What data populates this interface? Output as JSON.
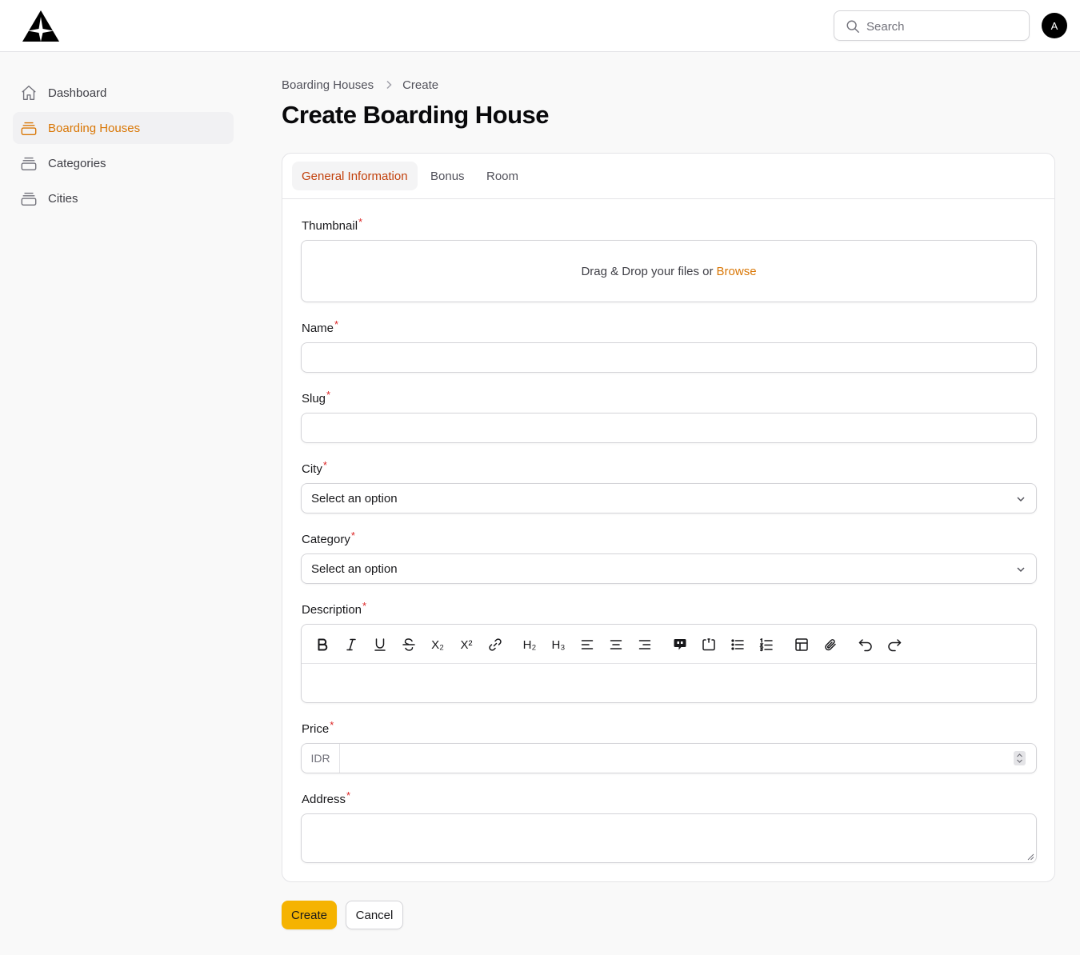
{
  "header": {
    "logo": "triangle-star-logo",
    "search_placeholder": "Search",
    "avatar_initial": "A"
  },
  "sidebar": {
    "items": [
      {
        "label": "Dashboard",
        "icon": "home-icon",
        "active": false
      },
      {
        "label": "Boarding Houses",
        "icon": "stack-icon",
        "active": true
      },
      {
        "label": "Categories",
        "icon": "stack-icon",
        "active": false
      },
      {
        "label": "Cities",
        "icon": "stack-icon",
        "active": false
      }
    ]
  },
  "breadcrumb": {
    "items": [
      "Boarding Houses",
      "Create"
    ]
  },
  "page": {
    "title": "Create Boarding House"
  },
  "tabs": [
    {
      "label": "General Information",
      "active": true
    },
    {
      "label": "Bonus",
      "active": false
    },
    {
      "label": "Room",
      "active": false
    }
  ],
  "form": {
    "required_mark": "*",
    "thumbnail": {
      "label": "Thumbnail",
      "dropzone_text": "Drag & Drop your files or",
      "browse_label": "Browse"
    },
    "name": {
      "label": "Name",
      "value": ""
    },
    "slug": {
      "label": "Slug",
      "value": ""
    },
    "city": {
      "label": "City",
      "selected": "Select an option"
    },
    "category": {
      "label": "Category",
      "selected": "Select an option"
    },
    "description": {
      "label": "Description",
      "toolbar": [
        "bold",
        "italic",
        "underline",
        "strike",
        "subscript",
        "superscript",
        "link",
        "h2",
        "h3",
        "align-start",
        "align-center",
        "align-end",
        "blockquote",
        "code-block",
        "bullet-list",
        "ordered-list",
        "table",
        "attach-files",
        "undo",
        "redo"
      ],
      "h2_label": "H₂",
      "h3_label": "H₃",
      "subscript_label": "X₂",
      "superscript_label": "X²"
    },
    "price": {
      "label": "Price",
      "prefix": "IDR",
      "value": ""
    },
    "address": {
      "label": "Address",
      "value": ""
    }
  },
  "actions": {
    "create_label": "Create",
    "cancel_label": "Cancel"
  },
  "colors": {
    "accent": "#d97706",
    "primary_button": "#f5b301",
    "required": "#dc2626"
  }
}
